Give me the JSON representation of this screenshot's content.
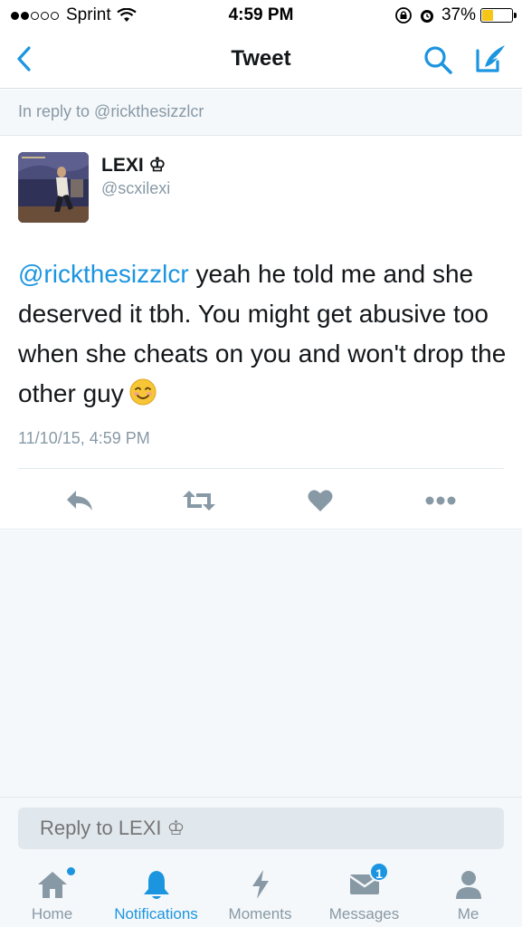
{
  "status_bar": {
    "carrier": "Sprint",
    "time": "4:59 PM",
    "battery_percent": "37%",
    "battery_level": 0.37,
    "signal_bars_filled": 2,
    "signal_bars_total": 5
  },
  "nav": {
    "title": "Tweet",
    "back_icon": "chevron-left-icon",
    "search_icon": "search-icon",
    "compose_icon": "compose-tweet-icon"
  },
  "reply_banner": {
    "text": "In reply to @rickthesizzlcr"
  },
  "tweet": {
    "display_name": "LEXI ♔",
    "handle": "@scxilexi",
    "mention": "@rickthesizzlcr",
    "body": " yeah he told me and she deserved it tbh. You might get abusive too when she cheats on you and won't drop the other guy",
    "emoji": "smiling-face-emoji",
    "timestamp": "11/10/15, 4:59 PM",
    "actions": [
      "reply-icon",
      "retweet-icon",
      "like-icon",
      "more-icon"
    ]
  },
  "composer": {
    "placeholder": "Reply to LEXI ♔"
  },
  "tabs": [
    {
      "label": "Home",
      "icon": "home-icon",
      "active": false,
      "has_dot": true
    },
    {
      "label": "Notifications",
      "icon": "bell-icon",
      "active": true
    },
    {
      "label": "Moments",
      "icon": "lightning-icon",
      "active": false
    },
    {
      "label": "Messages",
      "icon": "envelope-icon",
      "active": false,
      "badge": "1"
    },
    {
      "label": "Me",
      "icon": "person-icon",
      "active": false
    }
  ],
  "colors": {
    "accent": "#1b95e0",
    "muted": "#8899a6",
    "text": "#14171a",
    "battery": "#f5c518"
  }
}
